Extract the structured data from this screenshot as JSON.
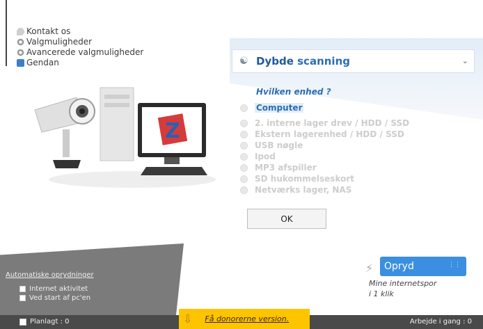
{
  "menu": {
    "items": [
      {
        "label": "Kontakt os",
        "icon": "chat-icon"
      },
      {
        "label": "Valgmuligheder",
        "icon": "gear-icon"
      },
      {
        "label": "Avancerede valgmuligheder",
        "icon": "gear-icon"
      },
      {
        "label": "Gendan",
        "icon": "restore-icon"
      }
    ]
  },
  "scan": {
    "mode_word1": "Dybde",
    "mode_word2": "scanning",
    "question": "Hvilken enhed ?",
    "devices": [
      {
        "label": "Computer",
        "selected": true
      },
      {
        "label": "2. interne lager drev / HDD / SSD"
      },
      {
        "label": "Ekstern lagerenhed  / HDD / SSD"
      },
      {
        "label": "USB nøgle"
      },
      {
        "label": "Ipod"
      },
      {
        "label": "MP3 afspiller"
      },
      {
        "label": "SD hukommelseskort"
      },
      {
        "label": "Netværks lager, NAS"
      }
    ],
    "ok_label": "OK"
  },
  "auto": {
    "title": "Automatiske oprydninger",
    "options": [
      "Internet aktivitet",
      "Ved start af pc'en"
    ]
  },
  "clean": {
    "button_label": "Opryd",
    "subtitle_line1": "Mine internetspor",
    "subtitle_line2": "i 1 klik"
  },
  "statusbar": {
    "planned": "Planlagt : 0",
    "donor": "Få donorerne version.",
    "work": "Arbejde i gang : 0"
  },
  "colors": {
    "accent": "#2e6db4",
    "button_blue": "#3a8fe0",
    "donor_yellow": "#ffc400"
  }
}
